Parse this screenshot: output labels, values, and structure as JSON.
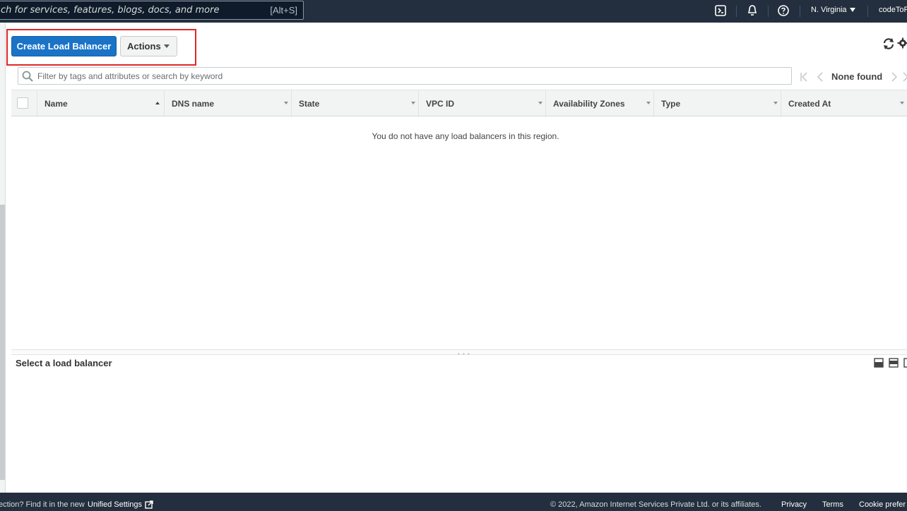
{
  "topbar": {
    "search_placeholder": "ch for services, features, blogs, docs, and more",
    "search_shortcut": "[Alt+S]",
    "region": "N. Virginia",
    "user": "codeToF"
  },
  "toolbar": {
    "create_label": "Create Load Balancer",
    "actions_label": "Actions"
  },
  "filter": {
    "placeholder": "Filter by tags and attributes or search by keyword",
    "pager_text": "None found"
  },
  "table": {
    "columns": [
      "Name",
      "DNS name",
      "State",
      "VPC ID",
      "Availability Zones",
      "Type",
      "Created At"
    ],
    "empty_message": "You do not have any load balancers in this region."
  },
  "details": {
    "title": "Select a load balancer"
  },
  "footer": {
    "settings_prompt": "ection? Find it in the new",
    "settings_link": "Unified Settings",
    "copyright": "© 2022, Amazon Internet Services Private Ltd. or its affiliates.",
    "privacy": "Privacy",
    "terms": "Terms",
    "cookie": "Cookie prefer"
  },
  "colors": {
    "nav_bg": "#232f3e",
    "primary": "#1a73c7",
    "highlight": "#e0262b"
  }
}
